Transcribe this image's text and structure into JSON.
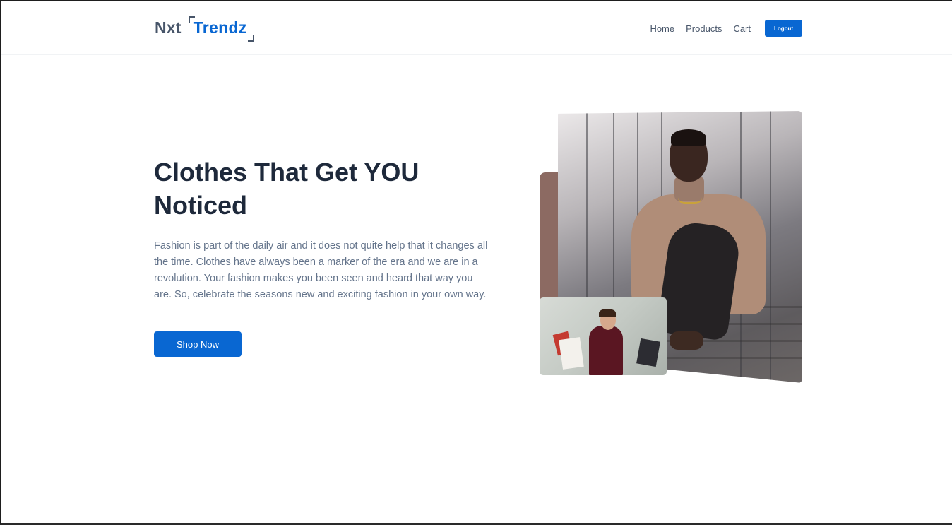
{
  "header": {
    "logo_part1": "Nxt",
    "logo_part2": "Trendz",
    "nav": [
      "Home",
      "Products",
      "Cart"
    ],
    "logout_label": "Logout"
  },
  "hero": {
    "heading": "Clothes That Get YOU Noticed",
    "description": "Fashion is part of the daily air and it does not quite help that it changes all the time. Clothes have always been a marker of the era and we are in a revolution. Your fashion makes you been seen and heard that way you are. So, celebrate the seasons new and exciting fashion in your own way.",
    "cta_label": "Shop Now"
  },
  "colors": {
    "brand": "#0967d2",
    "heading": "#1e293b",
    "text": "#64748b",
    "accent": "#8c6a62"
  }
}
